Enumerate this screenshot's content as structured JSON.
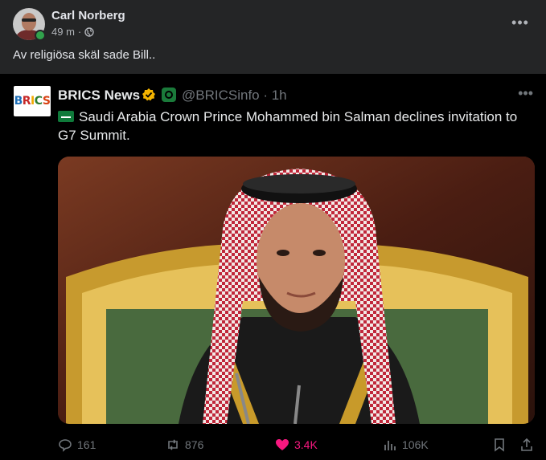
{
  "post": {
    "author": "Carl Norberg",
    "time": "49 m",
    "separator": "·",
    "caption": "Av religiösa skäl sade Bill.."
  },
  "tweet": {
    "name": "BRICS News",
    "avatar_text": "BRICS",
    "handle": "@BRICSinfo · 1h",
    "text": "Saudi Arabia Crown Prince Mohammed bin Salman declines invitation to G7 Summit.",
    "actions": {
      "replies": "161",
      "retweets": "876",
      "likes": "3.4K",
      "views": "106K"
    }
  },
  "colors": {
    "like": "#f91880",
    "online": "#31a24c",
    "verified": "#f4b400"
  },
  "icons": [
    "globe-icon",
    "more-icon",
    "verified-icon",
    "flag-icon",
    "reply-icon",
    "retweet-icon",
    "heart-icon",
    "views-icon",
    "bookmark-icon",
    "share-icon"
  ]
}
